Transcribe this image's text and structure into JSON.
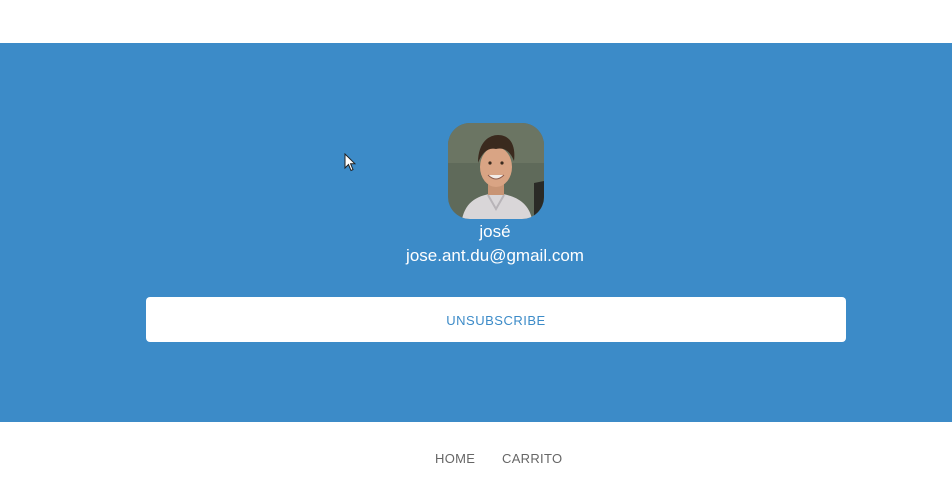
{
  "profile": {
    "name": "josé",
    "email": "jose.ant.du@gmail.com",
    "avatar_alt": "profile photo"
  },
  "actions": {
    "unsubscribe_label": "UNSUBSCRIBE"
  },
  "footer": {
    "nav": [
      {
        "label": "HOME"
      },
      {
        "label": "CARRITO"
      }
    ]
  },
  "colors": {
    "hero_background": "#3c8bc8",
    "button_text": "#3c8bc8",
    "nav_text": "#666666"
  }
}
